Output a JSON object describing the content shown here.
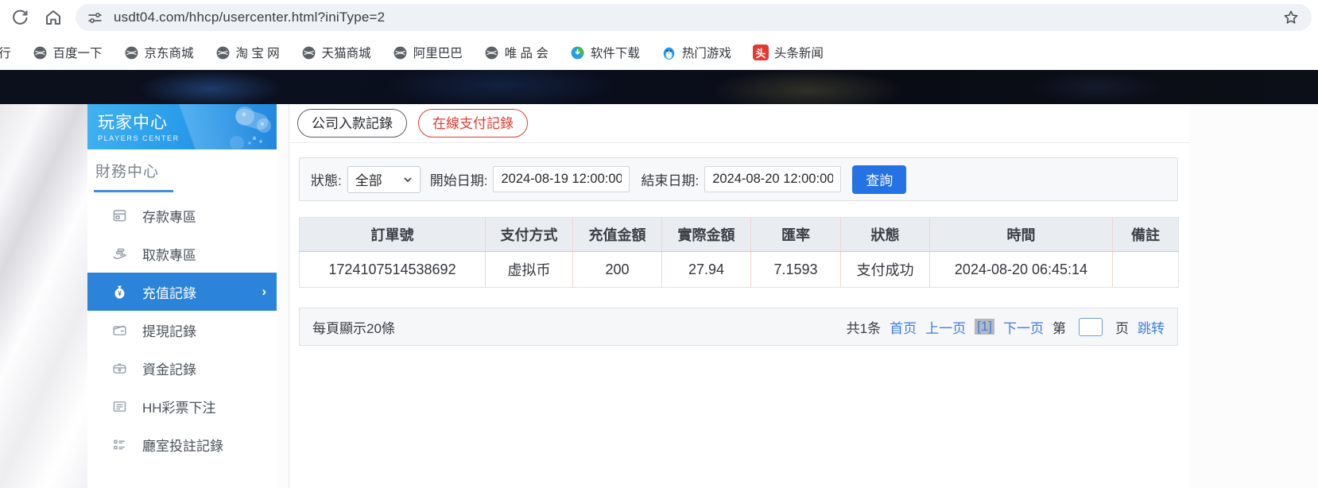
{
  "chrome": {
    "url": "usdt04.com/hhcp/usercenter.html?iniType=2",
    "bookmarks": [
      {
        "label": "行",
        "icon": "none"
      },
      {
        "label": "百度一下",
        "icon": "globe"
      },
      {
        "label": "京东商城",
        "icon": "globe"
      },
      {
        "label": "淘 宝 网",
        "icon": "globe"
      },
      {
        "label": "天猫商城",
        "icon": "globe"
      },
      {
        "label": "阿里巴巴",
        "icon": "globe"
      },
      {
        "label": "唯 品 会",
        "icon": "globe"
      },
      {
        "label": "软件下载",
        "icon": "download"
      },
      {
        "label": "热门游戏",
        "icon": "penguin"
      },
      {
        "label": "头条新闻",
        "icon": "toutiao",
        "icon_text": "头"
      }
    ]
  },
  "sidebar": {
    "title": "玩家中心",
    "subtitle": "PLAYERS CENTER",
    "section": "財務中心",
    "active_chevron": "›",
    "items": [
      {
        "label": "存款專區",
        "active": false
      },
      {
        "label": "取款專區",
        "active": false
      },
      {
        "label": "充值記錄",
        "active": true
      },
      {
        "label": "提現記錄",
        "active": false
      },
      {
        "label": "資金記錄",
        "active": false
      },
      {
        "label": "HH彩票下注",
        "active": false
      },
      {
        "label": "廳室投註記錄",
        "active": false
      }
    ]
  },
  "main": {
    "tabs": [
      {
        "label": "公司入款記錄",
        "active": false
      },
      {
        "label": "在線支付記錄",
        "active": true
      }
    ],
    "filters": {
      "status_label": "狀態:",
      "status_value": "全部",
      "start_label": "開始日期:",
      "start_value": "2024-08-19 12:00:00",
      "end_label": "結束日期:",
      "end_value": "2024-08-20 12:00:00",
      "query_label": "查詢"
    },
    "table": {
      "headers": [
        "訂單號",
        "支付方式",
        "充值金額",
        "實際金額",
        "匯率",
        "狀態",
        "時間",
        "備註"
      ],
      "rows": [
        [
          "1724107514538692",
          "虚拟币",
          "200",
          "27.94",
          "7.1593",
          "支付成功",
          "2024-08-20 06:45:14",
          ""
        ]
      ]
    },
    "pagination": {
      "page_size_text": "每頁顯示20條",
      "total_text": "共1条",
      "first": "首页",
      "prev": "上一页",
      "current": "[1]",
      "next": "下一页",
      "jump_pre": "第",
      "jump_input_value": "",
      "jump_post": "页",
      "jump_go": "跳转"
    }
  },
  "colors": {
    "accent_blue": "#2472e4",
    "sidebar_header_blue": "#2ba3ec",
    "active_item_blue": "#2b84d9",
    "tab_active_red": "#e23b33",
    "link_blue": "#3c7ee2",
    "table_header_bg": "#e9edf2",
    "table_divider_pink": "#f1d5ce",
    "toutiao_red": "#e23a30"
  }
}
